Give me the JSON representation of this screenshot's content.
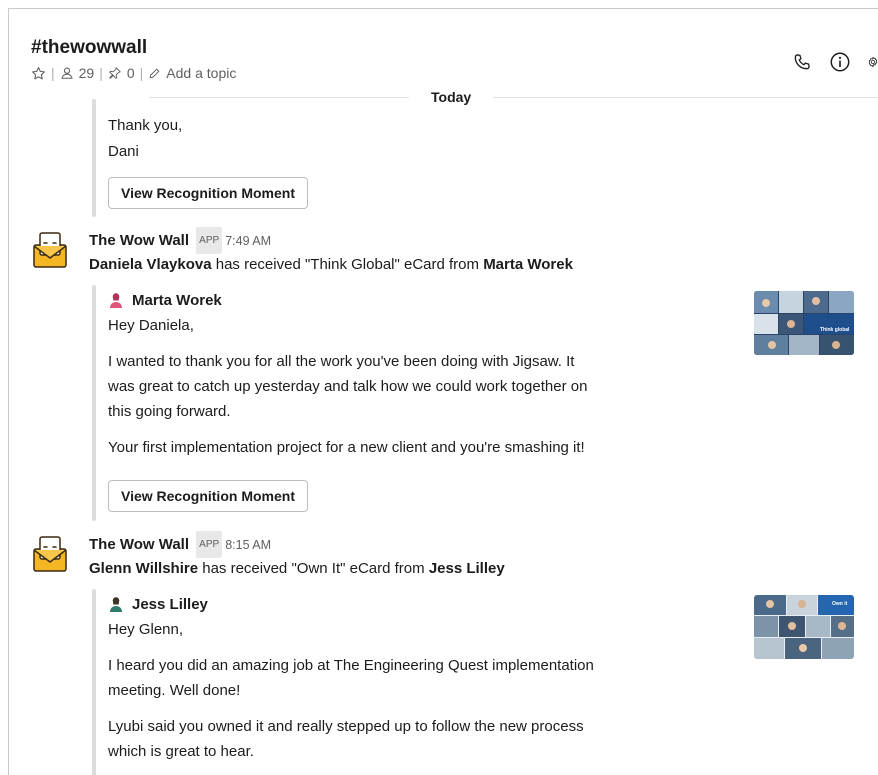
{
  "channel": {
    "name": "#thewowwall",
    "members": "29",
    "pins": "0",
    "topic_placeholder": "Add a topic"
  },
  "date_divider": "Today",
  "prev_message": {
    "lines": [
      "Thank you,",
      "Dani"
    ],
    "button": "View Recognition Moment"
  },
  "messages": [
    {
      "sender": "The Wow Wall",
      "badge": "APP",
      "time": "7:49 AM",
      "recipient": "Daniela Vlaykova",
      "card_text": " has received \"Think Global\" eCard from ",
      "giver": "Marta Worek",
      "author": "Marta Worek",
      "greeting": "Hey Daniela,",
      "para1": [
        "I wanted to thank you for all the work you've been doing with Jigsaw. It",
        "was great to catch up yesterday and talk how we could work together on",
        "this going forward."
      ],
      "para2": "Your first implementation project for a new client and you're smashing it!",
      "button": "View Recognition Moment",
      "thumb_caption": "Think global"
    },
    {
      "sender": "The Wow Wall",
      "badge": "APP",
      "time": "8:15 AM",
      "recipient": "Glenn Willshire",
      "card_text": " has received \"Own It\" eCard from ",
      "giver": "Jess Lilley",
      "author": "Jess Lilley",
      "greeting": "Hey Glenn,",
      "para1": [
        "I heard you did an amazing job at The Engineering Quest implementation",
        "meeting. Well done!"
      ],
      "para2": [
        "Lyubi said you owned it and really stepped up to follow the new process",
        "which is great to hear."
      ],
      "thumb_caption": "Own it"
    }
  ],
  "colors": {
    "text": "#1d1c1d",
    "muted": "#616061",
    "avatar_yellow": "#f5b623",
    "quote_bar": "#dddddd"
  },
  "icons": {
    "star": "star-icon",
    "members": "person-icon",
    "pin": "pin-icon",
    "pencil": "pencil-icon",
    "phone": "phone-icon",
    "info": "info-icon",
    "settings": "gear-icon"
  }
}
